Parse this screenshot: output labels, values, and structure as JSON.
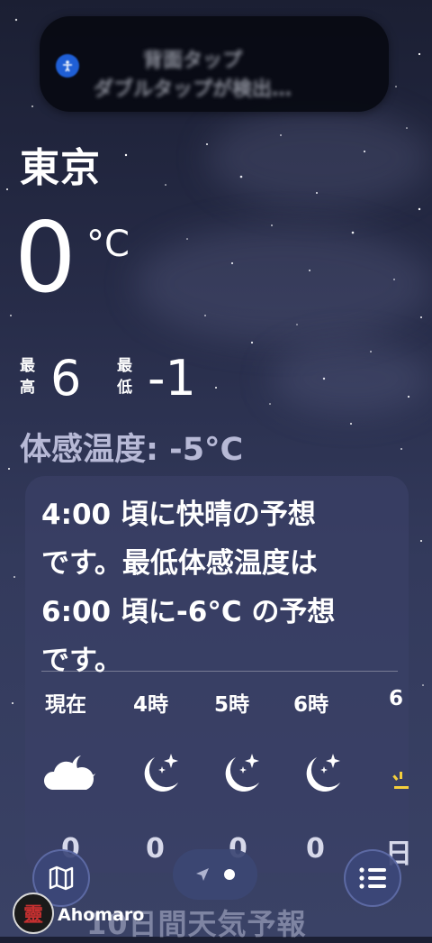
{
  "notification": {
    "title": "背面タップ",
    "subtitle": "ダブルタップが検出…"
  },
  "weather": {
    "city": "東京",
    "temperature": "0",
    "unit": "°C",
    "high_label": [
      "最",
      "高"
    ],
    "high_value": "6",
    "low_label": [
      "最",
      "低"
    ],
    "low_value": "-1",
    "feels_like": "体感温度: -5°C"
  },
  "forecast_card": {
    "summary_lines": [
      "4:00 頃に快晴の予想",
      "です。最低体感温度は",
      "6:00 頃に-6°C の予想",
      "です。"
    ],
    "hours": [
      {
        "label": "現在",
        "icon": "partly-cloudy-night-icon",
        "value": "0"
      },
      {
        "label": "4時",
        "icon": "clear-night-icon",
        "value": "0"
      },
      {
        "label": "5時",
        "icon": "clear-night-icon",
        "value": "0"
      },
      {
        "label": "6時",
        "icon": "clear-night-icon",
        "value": "0"
      },
      {
        "label": "6",
        "icon": "sunrise-icon",
        "value": "日"
      }
    ]
  },
  "bottom_bar": {
    "map_button": "map-icon",
    "location_button": "location-arrow-icon",
    "list_button": "list-icon",
    "faded_label": "10日間天気予報"
  },
  "watermark": {
    "logo_char": "靈",
    "text": "Ahomaro"
  }
}
